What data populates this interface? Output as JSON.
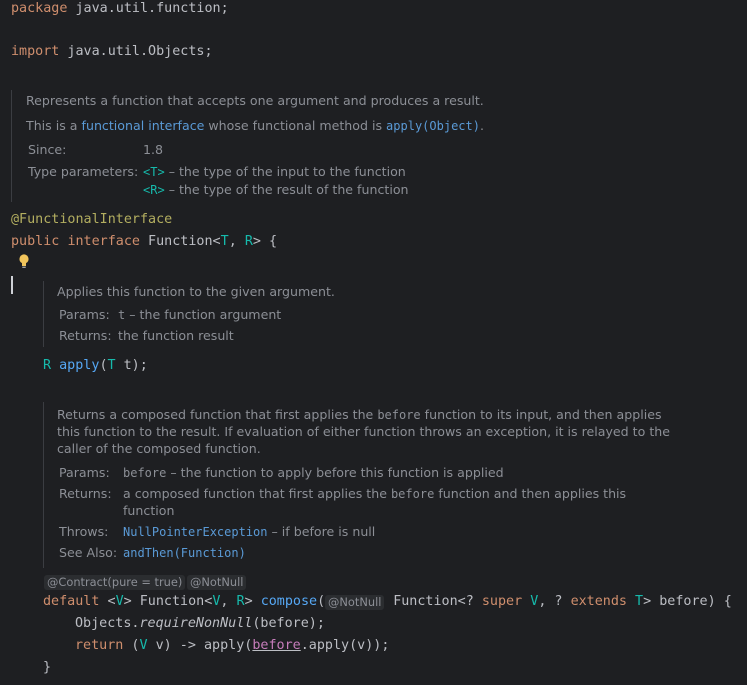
{
  "code": {
    "package_line": {
      "kw": "package",
      "rest": " java.util.function;"
    },
    "import_line": {
      "kw": "import",
      "rest": " java.util.Objects;"
    },
    "annotation": "@FunctionalInterface",
    "decl": {
      "kw1": "public",
      "kw2": "interface",
      "name": " Function<",
      "t": "T",
      "comma": ", ",
      "r": "R",
      "end": "> {"
    },
    "apply_line": {
      "r": "R",
      "name": "apply",
      "open": "(",
      "t": "T",
      "rest": " t);"
    },
    "compose_line": {
      "kw": "default",
      "lt": " <",
      "v": "V",
      "gt": "> Function<",
      "v2": "V",
      "sep": ", ",
      "r": "R",
      "close": "> ",
      "name": "compose",
      "paren": "(",
      "type": "Function<? ",
      "super": "super",
      "v3": " V",
      "sep2": ", ? ",
      "extends": "extends",
      "t": " T",
      "end": "> before) {"
    },
    "require_line": {
      "obj": "Objects.",
      "method": "requireNonNull",
      "rest": "(before);"
    },
    "return_line": {
      "kw": "return",
      "p1": " (",
      "v": "V",
      "p2": " v) -> apply(",
      "before": "before",
      "p3": ".apply(v));"
    },
    "closing_brace": "}"
  },
  "inlays": {
    "contract": "@Contract(pure = true)",
    "notnull": "@NotNull",
    "param_notnull": "@NotNull"
  },
  "doc1": {
    "summary": "Represents a function that accepts one argument and produces a result.",
    "line2_a": "This is a ",
    "line2_link": "functional interface",
    "line2_b": " whose functional method is ",
    "line2_code": "apply(Object)",
    "line2_c": ".",
    "since_label": "Since:",
    "since_value": "1.8",
    "tp_label": "Type parameters:",
    "tp1_code": "<T>",
    "tp1_text": " – the type of the input to the function",
    "tp2_code": "<R>",
    "tp2_text": " – the type of the result of the function"
  },
  "doc2": {
    "summary": "Applies this function to the given argument.",
    "params_label": "Params:",
    "param_code": "t",
    "param_text": " – the function argument",
    "returns_label": "Returns:",
    "returns_text": "the function result"
  },
  "doc3": {
    "l1a": "Returns a composed function that first applies the ",
    "l1code": "before",
    "l1b": " function to its input, and then applies",
    "l2": "this function to the result. If evaluation of either function throws an exception, it is relayed to the",
    "l3": "caller of the composed function.",
    "params_label": "Params:",
    "param_code": "before",
    "param_text": " – the function to apply before this function is applied",
    "returns_label": "Returns:",
    "returns_a": "a composed function that first applies the ",
    "returns_code": "before",
    "returns_b": " function and then applies this",
    "returns_c": "function",
    "throws_label": "Throws:",
    "throws_code": "NullPointerException",
    "throws_text": " – if before is null",
    "see_label": "See Also:",
    "see_code": "andThen(Function)"
  }
}
